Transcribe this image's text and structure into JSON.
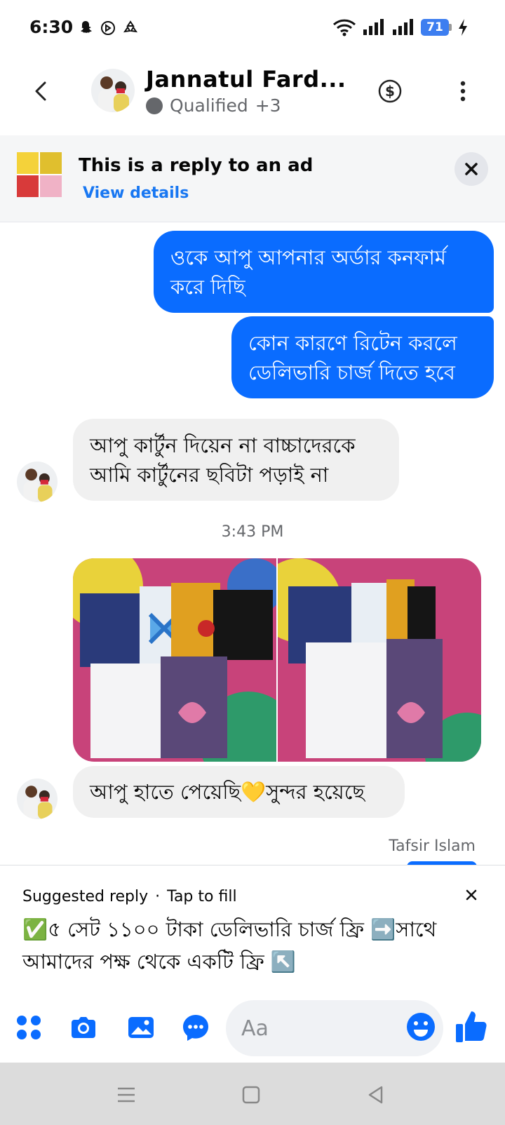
{
  "status_bar": {
    "time": "6:30",
    "battery": "71",
    "left_icons": [
      "snapchat-icon",
      "sync-icon",
      "recycle-icon"
    ],
    "right_icons": [
      "wifi-icon",
      "signal-icon",
      "signal-icon",
      "battery-icon",
      "charging-icon"
    ]
  },
  "header": {
    "contact_name": "Jannatul Fard...",
    "status_label": "Qualified",
    "status_extra": "+3"
  },
  "ad_banner": {
    "title": "This is a reply to an ad",
    "link": "View details"
  },
  "messages": {
    "m1": "ওকে আপু আপনার অর্ডার কনফার্ম করে দিছি",
    "m2": "কোন কারণে রিটেন করলে ডেলিভারি চার্জ দিতে হবে",
    "m3": "আপু কার্টুন দিয়েন না বাচ্চাদেরকে আমি কার্টুনের ছবিটা পড়াই না",
    "timestamp": "3:43 PM",
    "m4": "আপু হাতে পেয়েছি💛সুন্দর হয়েছে",
    "sender_label": "Tafsir Islam"
  },
  "suggested_reply": {
    "label": "Suggested reply",
    "separator": "·",
    "hint": "Tap to fill",
    "text": "✅৫ সেট ১১০০ টাকা ডেলিভারি চার্জ ফ্রি ➡️সাথে আমাদের পক্ষ থেকে একটি ফ্রি ↖️"
  },
  "composer": {
    "placeholder": "Aa"
  },
  "colors": {
    "accent": "#0a6cff",
    "incoming_bubble": "#f0f0f0",
    "secondary_text": "#65676b"
  }
}
